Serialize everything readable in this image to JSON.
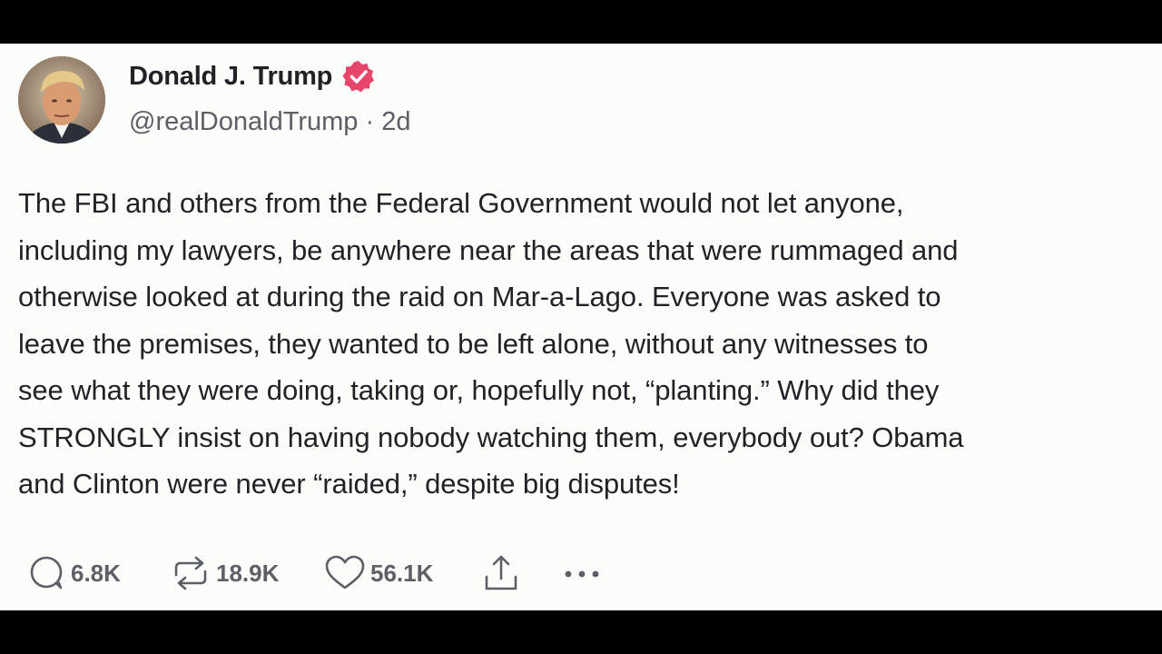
{
  "post": {
    "author": {
      "display_name": "Donald J. Trump",
      "verified": true,
      "handle": "@realDonaldTrump",
      "separator": " · ",
      "time": "2d"
    },
    "body_lines": [
      "The FBI and others from the Federal Government would not let anyone,",
      "including my lawyers, be anywhere near the areas that were rummaged and",
      "otherwise looked at during the raid on Mar-a-Lago. Everyone was asked to",
      "leave the premises, they wanted to be left alone, without any witnesses to",
      "see what they were doing, taking or, hopefully not, “planting.” Why did they",
      "STRONGLY insist on having nobody watching them, everybody out? Obama",
      "and Clinton were never “raided,” despite big disputes!"
    ],
    "actions": {
      "replies": {
        "icon": "reply-icon",
        "count": "6.8K"
      },
      "reposts": {
        "icon": "repost-icon",
        "count": "18.9K"
      },
      "likes": {
        "icon": "heart-icon",
        "count": "56.1K"
      },
      "share": {
        "icon": "share-icon"
      },
      "more": {
        "icon": "more-icon"
      }
    }
  },
  "colors": {
    "background": "#fbfdfb",
    "text": "#1f2326",
    "secondary_text": "#5b6066",
    "verified_badge": "#e8456b"
  }
}
